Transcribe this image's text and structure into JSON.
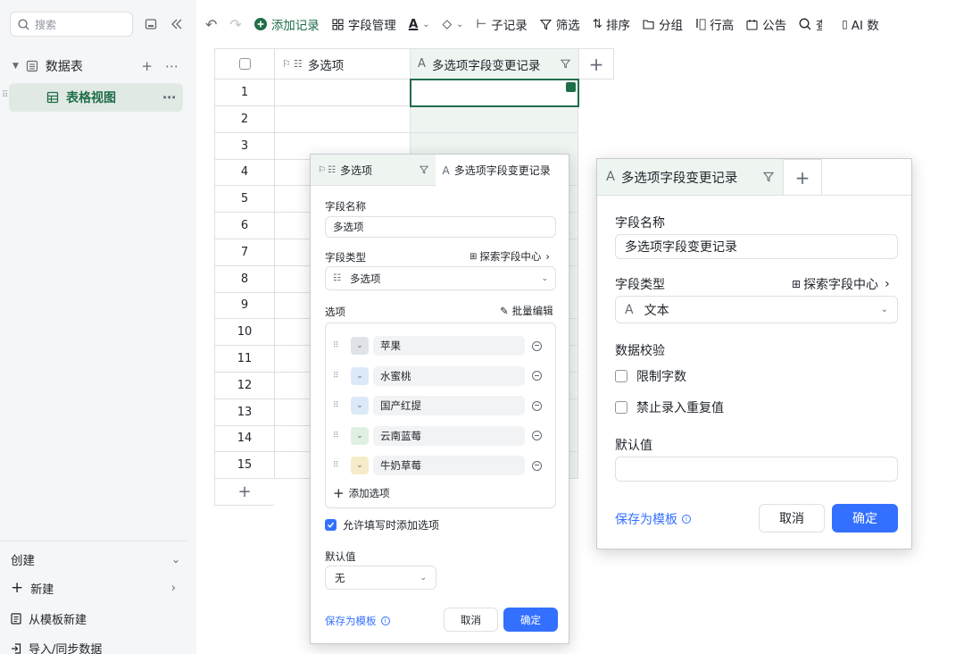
{
  "sidebar": {
    "search_placeholder": "搜索",
    "datatable_label": "数据表",
    "view_label": "表格视图",
    "create_label": "创建",
    "new_label": "新建",
    "from_template_label": "从模板新建",
    "import_label": "导入/同步数据"
  },
  "toolbar": {
    "add_record": "添加记录",
    "field_manage": "字段管理",
    "sub_record": "子记录",
    "filter": "筛选",
    "sort": "排序",
    "group": "分组",
    "row_height": "行高",
    "notice": "公告",
    "search_partial": "查",
    "ai": "AI 数"
  },
  "grid": {
    "col_multi": "多选项",
    "col_text": "多选项字段变更记录",
    "rows": [
      "1",
      "2",
      "3",
      "4",
      "5",
      "6",
      "7",
      "8",
      "9",
      "10",
      "11",
      "12",
      "13",
      "14",
      "15"
    ]
  },
  "popup1": {
    "tab_a": "多选项",
    "tab_b": "多选项字段变更记录",
    "field_name_label": "字段名称",
    "field_name_value": "多选项",
    "field_type_label": "字段类型",
    "explore_link": "探索字段中心",
    "field_type_value": "多选项",
    "options_label": "选项",
    "batch_edit": "批量编辑",
    "options": [
      {
        "name": "苹果",
        "color": "#dfe3e8"
      },
      {
        "name": "水蜜桃",
        "color": "#dceaf8"
      },
      {
        "name": "国产红提",
        "color": "#dceaf8"
      },
      {
        "name": "云南蓝莓",
        "color": "#dff0e3"
      },
      {
        "name": "牛奶草莓",
        "color": "#f7ecc9"
      }
    ],
    "add_option": "添加选项",
    "allow_add_label": "允许填写时添加选项",
    "default_label": "默认值",
    "default_value": "无",
    "save_template": "保存为模板",
    "cancel": "取消",
    "confirm": "确定"
  },
  "popup2": {
    "tab_a": "多选项字段变更记录",
    "field_name_label": "字段名称",
    "field_name_value": "多选项字段变更记录",
    "field_type_label": "字段类型",
    "explore_link": "探索字段中心",
    "field_type_value": "文本",
    "validation_label": "数据校验",
    "limit_chars": "限制字数",
    "no_duplicates": "禁止录入重复值",
    "default_label": "默认值",
    "save_template": "保存为模板",
    "cancel": "取消",
    "confirm": "确定"
  }
}
